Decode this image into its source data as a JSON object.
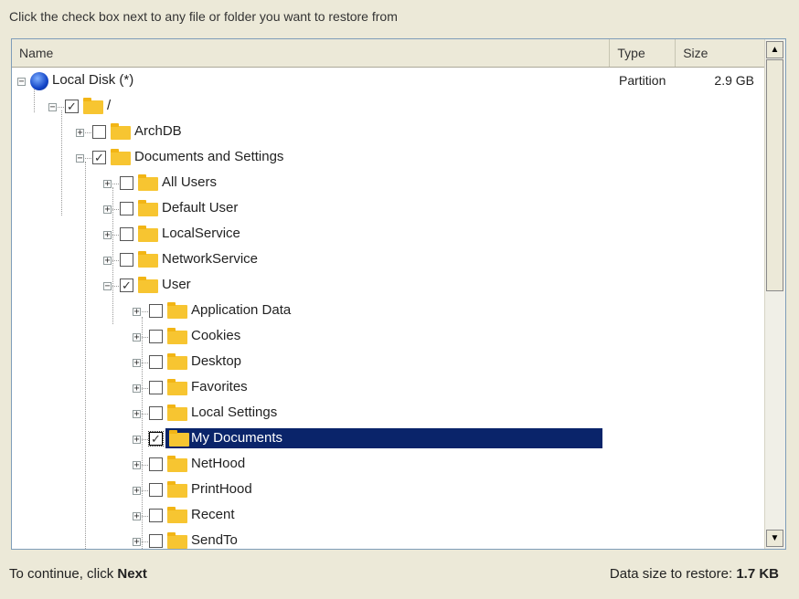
{
  "instruction": "Click the check box next to any file or folder you want to restore from",
  "columns": {
    "name": "Name",
    "type": "Type",
    "size": "Size"
  },
  "root": {
    "label": "Local Disk (*)",
    "type": "Partition",
    "size": "2.9 GB"
  },
  "tree": [
    {
      "label": "/"
    },
    {
      "label": "ArchDB"
    },
    {
      "label": "Documents and Settings"
    },
    {
      "label": "All Users"
    },
    {
      "label": "Default User"
    },
    {
      "label": "LocalService"
    },
    {
      "label": "NetworkService"
    },
    {
      "label": "User"
    },
    {
      "label": "Application Data"
    },
    {
      "label": "Cookies"
    },
    {
      "label": "Desktop"
    },
    {
      "label": "Favorites"
    },
    {
      "label": "Local Settings"
    },
    {
      "label": "My Documents"
    },
    {
      "label": "NetHood"
    },
    {
      "label": "PrintHood"
    },
    {
      "label": "Recent"
    },
    {
      "label": "SendTo"
    }
  ],
  "scroll": {
    "up_glyph": "▲",
    "down_glyph": "▼"
  },
  "footer": {
    "continue_prefix": "To continue, click ",
    "continue_action": "Next",
    "data_size_label": "Data size to restore: ",
    "data_size_value": "1.7 KB"
  }
}
